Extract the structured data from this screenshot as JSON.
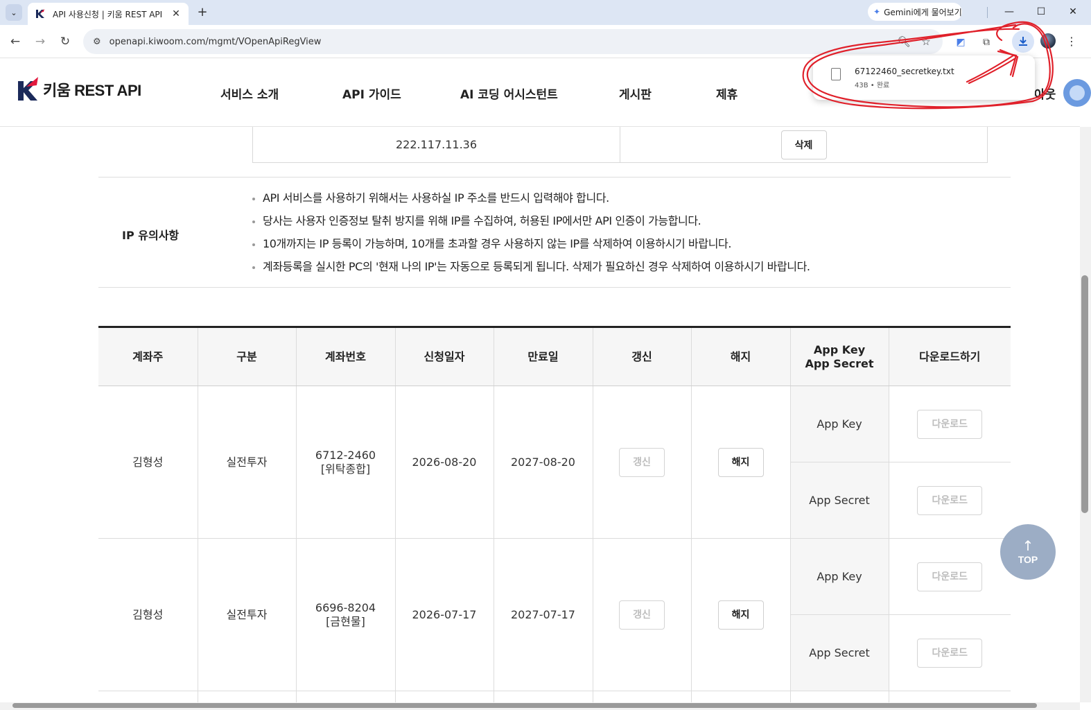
{
  "browser": {
    "tab_title": "API 사용신청 | 키움 REST API",
    "tab_close": "✕",
    "new_tab": "+",
    "gemini_label": "Gemini에게 물어보기",
    "url": "openapi.kiwoom.com/mgmt/VOpenApiRegView",
    "window_controls": {
      "minimize": "—",
      "maximize": "☐",
      "close": "✕"
    },
    "icons": [
      "tab-search-icon",
      "back-icon",
      "forward-icon",
      "reload-icon",
      "site-settings-icon",
      "zoom-icon",
      "bookmark-star-icon",
      "translate-icon",
      "extensions-icon",
      "download-icon",
      "profile-avatar-icon",
      "menu-icon"
    ]
  },
  "download_bubble": {
    "filename": "67122460_secretkey.txt",
    "meta": "43B • 완료"
  },
  "header": {
    "logo_text": "키움 REST API",
    "nav": [
      "서비스 소개",
      "API 가이드",
      "AI 코딩 어시스턴트",
      "게시판",
      "제휴"
    ],
    "logout_partial": "아웃"
  },
  "ip_registry": {
    "ip_address": "222.117.11.36",
    "delete_label": "삭제"
  },
  "ip_notice": {
    "label": "IP 유의사항",
    "items": [
      "API 서비스를 사용하기 위해서는 사용하실 IP 주소를 반드시 입력해야 합니다.",
      "당사는 사용자 인증정보 탈취 방지를 위해 IP를 수집하여, 허용된 IP에서만 API 인증이 가능합니다.",
      "10개까지는 IP 등록이 가능하며, 10개를 초과할 경우 사용하지 않는 IP를 삭제하여 이용하시기 바랍니다.",
      "계좌등록을 실시한 PC의 '현재 나의 IP'는 자동으로 등록되게 됩니다. 삭제가 필요하신 경우 삭제하여 이용하시기 바랍니다."
    ]
  },
  "accounts_table": {
    "headers": [
      "계좌주",
      "구분",
      "계좌번호",
      "신청일자",
      "만료일",
      "갱신",
      "해지",
      "App Key\nApp Secret",
      "다운로드하기"
    ],
    "header_key_line1": "App Key",
    "header_key_line2": "App Secret",
    "renew_label": "갱신",
    "cancel_label": "해지",
    "download_label": "다운로드",
    "app_key_label": "App Key",
    "app_secret_label": "App Secret",
    "rows": [
      {
        "owner": "김형성",
        "type": "실전투자",
        "account_no": "6712-2460",
        "account_kind": "[위탁종합]",
        "applied": "2026-08-20",
        "expires": "2027-08-20"
      },
      {
        "owner": "김형성",
        "type": "실전투자",
        "account_no": "6696-8204",
        "account_kind": "[금현물]",
        "applied": "2026-07-17",
        "expires": "2027-07-17"
      }
    ]
  },
  "top_button": {
    "label": "TOP"
  },
  "colors": {
    "brand_red": "#e2183d",
    "brand_navy": "#1b2a5a",
    "annotation_red": "#e0202a",
    "download_accent": "#1a5dc9"
  }
}
